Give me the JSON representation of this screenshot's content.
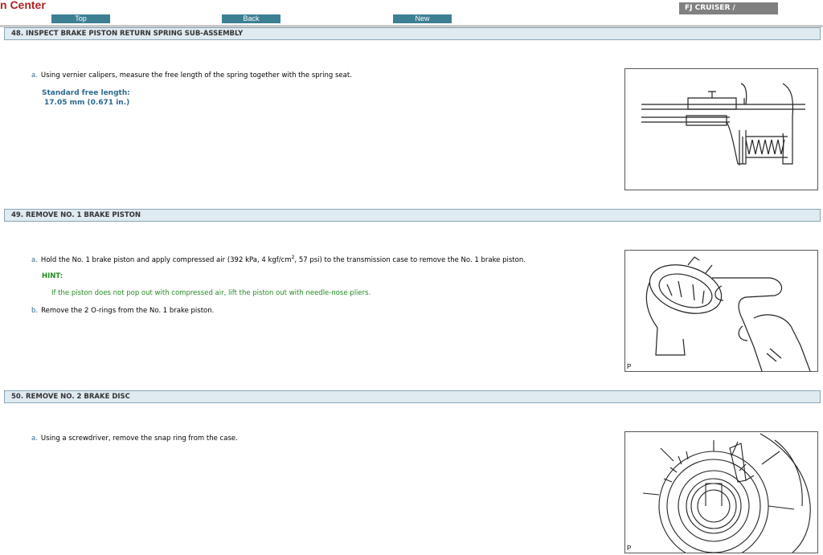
{
  "header": {
    "brand": "n Center",
    "nav": {
      "top": "Top",
      "back": "Back",
      "new": "New"
    },
    "model": "FJ CRUISER /"
  },
  "sections": [
    {
      "title": "48. INSPECT BRAKE PISTON RETURN SPRING SUB-ASSEMBLY",
      "steps": [
        {
          "letter": "a.",
          "text": "Using vernier calipers, measure the free length of the spring together with the spring seat."
        }
      ],
      "spec_label": "Standard free length:",
      "spec_value": "17.05 mm (0.671 in.)",
      "figure": {
        "icon": "vernier-caliper-spring-illustration"
      }
    },
    {
      "title": "49. REMOVE NO. 1 BRAKE PISTON",
      "steps": [
        {
          "letter": "a.",
          "text_pre": "Hold the No. 1 brake piston and apply compressed air (392 kPa, 4 kgf/cm",
          "sup": "2",
          "text_post": ", 57 psi) to the transmission case to remove the No. 1 brake piston."
        },
        {
          "letter": "b.",
          "text": "Remove the 2 O-rings from the No. 1 brake piston."
        }
      ],
      "hint_label": "HINT:",
      "hint_text": "If the piston does not pop out with compressed air, lift the piston out with needle-nose pliers.",
      "figure": {
        "icon": "compressed-air-brake-piston-illustration",
        "label": "P"
      }
    },
    {
      "title": "50. REMOVE NO. 2 BRAKE DISC",
      "steps": [
        {
          "letter": "a.",
          "text": "Using a screwdriver, remove the snap ring from the case."
        }
      ],
      "figure": {
        "icon": "screwdriver-snap-ring-illustration",
        "label": "P"
      }
    }
  ]
}
